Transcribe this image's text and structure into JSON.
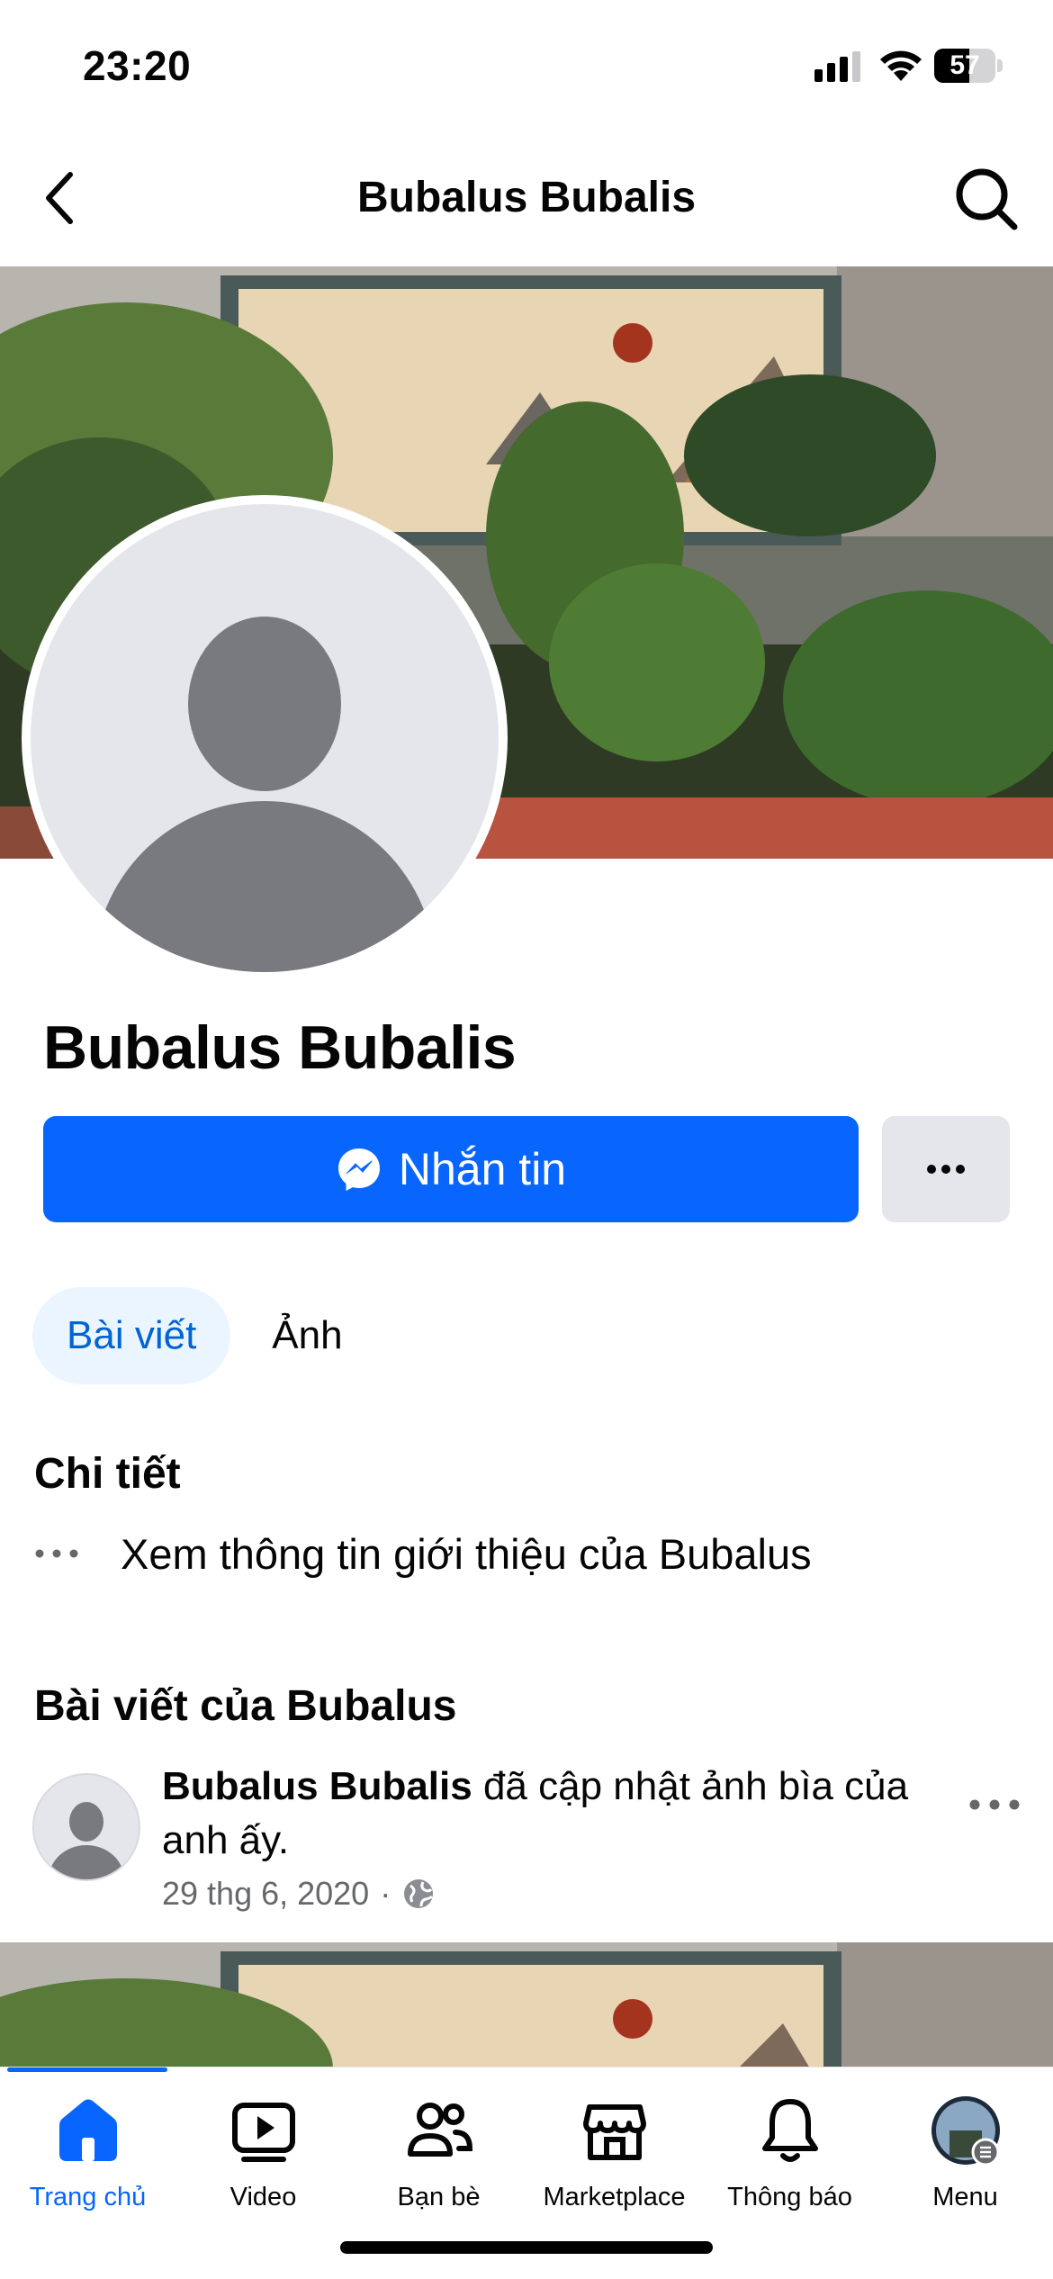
{
  "status_bar": {
    "time": "23:20",
    "battery_percent": "57",
    "battery_level": 0.57
  },
  "header": {
    "title": "Bubalus Bubalis"
  },
  "profile": {
    "name": "Bubalus Bubalis",
    "message_button_label": "Nhắn tin"
  },
  "tabs": [
    {
      "label": "Bài viết",
      "active": true
    },
    {
      "label": "Ảnh",
      "active": false
    }
  ],
  "details": {
    "title": "Chi tiết",
    "see_intro": "Xem thông tin giới thiệu của Bubalus"
  },
  "posts_section": {
    "title": "Bài viết của Bubalus",
    "post": {
      "author": "Bubalus Bubalis",
      "action": " đã cập nhật ảnh bìa của anh ấy.",
      "date": "29 thg 6, 2020",
      "separator": "·"
    }
  },
  "bottom_nav": [
    {
      "label": "Trang chủ",
      "icon": "home-icon",
      "active": true
    },
    {
      "label": "Video",
      "icon": "video-icon",
      "active": false
    },
    {
      "label": "Bạn bè",
      "icon": "friends-icon",
      "active": false
    },
    {
      "label": "Marketplace",
      "icon": "marketplace-icon",
      "active": false
    },
    {
      "label": "Thông báo",
      "icon": "bell-icon",
      "active": false
    },
    {
      "label": "Menu",
      "icon": "profile-menu-icon",
      "active": false
    }
  ],
  "colors": {
    "primary": "#0866ff",
    "tab_active_bg": "#ebf5ff",
    "tab_active_text": "#0064d1",
    "secondary_button": "#e4e6eb",
    "muted_text": "#65676b"
  }
}
